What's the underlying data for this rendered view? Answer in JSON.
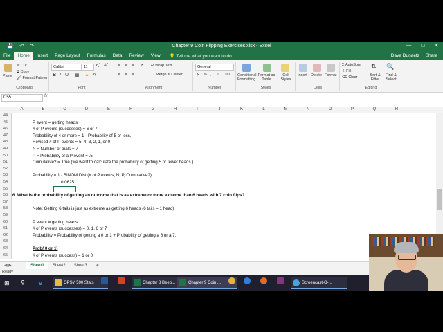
{
  "window": {
    "title": "Chapter 9 Coin Flipping Exercises.xlsx - Excel"
  },
  "menu": {
    "tabs": [
      "File",
      "Home",
      "Insert",
      "Page Layout",
      "Formulas",
      "Data",
      "Review",
      "View"
    ],
    "active": "Home",
    "tell_me": "Tell me what you want to do...",
    "user": "Dave Dunaetz",
    "share": "Share"
  },
  "ribbon": {
    "clipboard": {
      "paste": "Paste",
      "cut": "Cut",
      "copy": "Copy",
      "format_painter": "Format Painter",
      "label": "Clipboard"
    },
    "font": {
      "name": "Calibri",
      "size": "11",
      "label": "Font"
    },
    "alignment": {
      "wrap": "Wrap Text",
      "merge": "Merge & Center",
      "label": "Alignment"
    },
    "number": {
      "format": "General",
      "label": "Number"
    },
    "styles": {
      "conditional": "Conditional Formatting",
      "format_table": "Format as Table",
      "cell_styles": "Cell Styles",
      "label": "Styles"
    },
    "cells": {
      "insert": "Insert",
      "delete": "Delete",
      "format": "Format",
      "label": "Cells"
    },
    "editing": {
      "autosum": "AutoSum",
      "fill": "Fill",
      "clear": "Clear",
      "sort": "Sort & Filter",
      "find": "Find & Select",
      "label": "Editing"
    }
  },
  "formula_bar": {
    "name_box": "C55",
    "fx": "fx"
  },
  "columns": [
    "A",
    "B",
    "C",
    "D",
    "E",
    "F",
    "G",
    "H",
    "I",
    "J",
    "K",
    "L",
    "M",
    "N",
    "O",
    "P",
    "Q",
    "R"
  ],
  "rows": [
    {
      "num": "44",
      "text": ""
    },
    {
      "num": "45",
      "text": "P event = getting heads"
    },
    {
      "num": "46",
      "text": "# of P events (successes) = 6 or 7"
    },
    {
      "num": "47",
      "text": "Probability of 4 or more = 1 - Probability of 5 or less."
    },
    {
      "num": "48",
      "text": "Revised # of P events = 5, 4, 3, 2, 1, or 0"
    },
    {
      "num": "49",
      "text": "N = Number of trials = 7"
    },
    {
      "num": "50",
      "text": "P = Probability of a P event = .5"
    },
    {
      "num": "51",
      "text": "Cumulative? = True (we want to calculate the probability of getting 5 or fewer heads.)"
    },
    {
      "num": "52",
      "text": ""
    },
    {
      "num": "53",
      "text": "Probability = 1 - BINOM.Dist (# of P events, N, P, Cumulative?)"
    },
    {
      "num": "54",
      "text": "0.0625"
    },
    {
      "num": "55",
      "text": ""
    },
    {
      "num": "56",
      "text": "6. What is the probability of getting an outcome that is as extreme or more extreme than 6 heads with 7 coin flips?"
    },
    {
      "num": "57",
      "text": ""
    },
    {
      "num": "58",
      "text": "Note: Getting 6 tails is just as extreme as getting 6 heads (6 tails = 1 head)"
    },
    {
      "num": "59",
      "text": ""
    },
    {
      "num": "60",
      "text": "P event = getting heads"
    },
    {
      "num": "61",
      "text": "# of P events (successes) = 0, 1, 6 or 7"
    },
    {
      "num": "62",
      "text": "Probability = Probability of getting a 0 or 1 + Probability of getting a 6 or a 7."
    },
    {
      "num": "63",
      "text": ""
    },
    {
      "num": "64",
      "text": "Prob( 0 or 1)"
    },
    {
      "num": "65",
      "text": "# of P events (success) = 1 or 0"
    }
  ],
  "sheets": [
    "Sheet1",
    "Sheet2",
    "Sheet3"
  ],
  "active_sheet": "Sheet1",
  "status": "Ready",
  "taskbar": {
    "apps": [
      "OPSY 590 Stats",
      "Chapter 8 Beep...",
      "Chapter 9 Coin ...",
      "Screencast-O-..."
    ]
  }
}
